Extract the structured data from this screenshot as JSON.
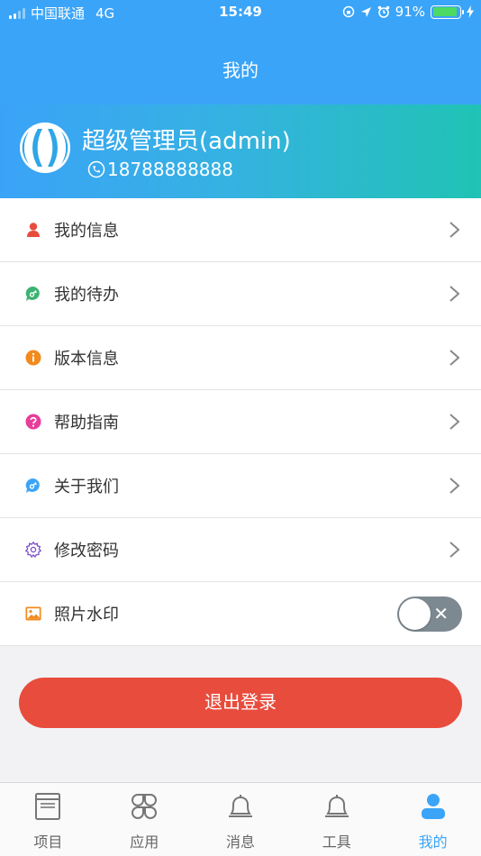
{
  "status_bar": {
    "carrier": "中国联通",
    "network": "4G",
    "time": "15:49",
    "battery": "91%",
    "battery_level": 0.91
  },
  "header": {
    "title": "我的"
  },
  "profile": {
    "name": "超级管理员(admin)",
    "phone": "18788888888"
  },
  "menu": {
    "items": [
      {
        "label": "我的信息",
        "icon": "user-icon",
        "color": "#e84c3d"
      },
      {
        "label": "我的待办",
        "icon": "todo-chat-icon",
        "color": "#3cb371"
      },
      {
        "label": "版本信息",
        "icon": "info-icon",
        "color": "#f28a1e"
      },
      {
        "label": "帮助指南",
        "icon": "help-icon",
        "color": "#e83c9a"
      },
      {
        "label": "关于我们",
        "icon": "about-chat-icon",
        "color": "#3aa4f8"
      },
      {
        "label": "修改密码",
        "icon": "gear-icon",
        "color": "#7b4fc9"
      },
      {
        "label": "照片水印",
        "icon": "image-icon",
        "color": "#f28a1e"
      }
    ],
    "watermark_enabled": false
  },
  "logout": {
    "label": "退出登录",
    "color": "#e84c3d"
  },
  "tabbar": {
    "tabs": [
      {
        "label": "项目",
        "icon": "project-icon"
      },
      {
        "label": "应用",
        "icon": "apps-icon"
      },
      {
        "label": "消息",
        "icon": "bell-icon"
      },
      {
        "label": "工具",
        "icon": "tools-bell-icon"
      },
      {
        "label": "我的",
        "icon": "person-icon",
        "active": true
      }
    ]
  },
  "colors": {
    "primary": "#3aa4f8",
    "gradient_end": "#20c3b4",
    "danger": "#e84c3d"
  }
}
